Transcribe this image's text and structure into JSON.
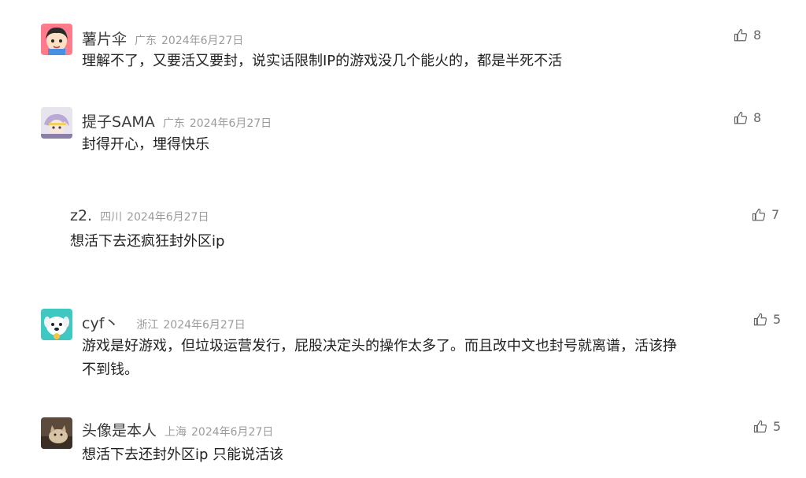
{
  "comments": [
    {
      "username": "薯片伞",
      "location": "广东",
      "date": "2024年6月27日",
      "text": "理解不了，又要活又要封，说实话限制IP的游戏没几个能火的，都是半死不活",
      "likes": "8",
      "avatar_icon": "cartoon-girl-avatar"
    },
    {
      "username": "提子SAMA",
      "location": "广东",
      "date": "2024年6月27日",
      "text": "封得开心，埋得快乐",
      "likes": "8",
      "avatar_icon": "anime-character-avatar"
    },
    {
      "username": "z2.",
      "location": "四川",
      "date": "2024年6月27日",
      "text": "想活下去还疯狂封外区ip",
      "likes": "7"
    },
    {
      "username": "cyf丶",
      "location": "浙江",
      "date": "2024年6月27日",
      "text_line1": "游戏是好游戏，但垃圾运营发行，屁股决定头的操作太多了。而且改中文也封号就离谱，活该挣",
      "text_line2": "不到钱。",
      "likes": "5",
      "avatar_icon": "cartoon-dog-avatar"
    },
    {
      "username": "头像是本人",
      "location": "上海",
      "date": "2024年6月27日",
      "text": "想活下去还封外区ip 只能说活该",
      "likes": "5",
      "avatar_icon": "cat-photo-avatar"
    }
  ],
  "colors": {
    "username": "#3a3a3a",
    "meta": "#9b9b9b",
    "text": "#222222",
    "like": "#666666"
  }
}
